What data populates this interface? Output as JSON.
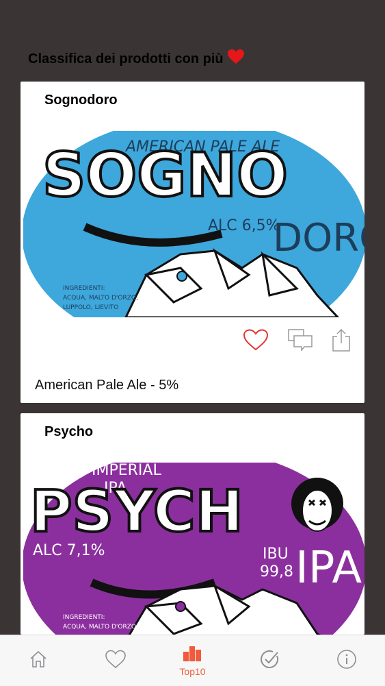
{
  "header": {
    "title": "Classifica dei prodotti con più",
    "heart_icon": "heart-icon"
  },
  "products": [
    {
      "name": "Sognodoro",
      "label": {
        "style": "AMERICAN PALE ALE",
        "word_top": "SOGNO",
        "word_side": "DORO",
        "alc": "ALC 6,5%",
        "ingredients": [
          "INGREDIENTI:",
          "ACQUA, MALTO D'ORZO,",
          "LUPPOLO, LIEVITO"
        ],
        "color": "#3ea7dc"
      },
      "subtitle": "American Pale Ale - 5%"
    },
    {
      "name": "Psycho",
      "label": {
        "style_line1": "IMPERIAL",
        "style_line2": "IPA",
        "word": "PSYCH",
        "alc": "ALC 7,1%",
        "ibu_line1": "IBU",
        "ibu_line2": "99,8",
        "ipa": "IPA",
        "ingredients": [
          "INGREDIENTI:",
          "ACQUA, MALTO D'ORZO,"
        ],
        "color": "#8c2f9e"
      }
    }
  ],
  "actions": {
    "like": "heart-outline-icon",
    "comment": "comments-icon",
    "share": "share-icon"
  },
  "tabbar": {
    "tabs": [
      {
        "icon": "home-icon",
        "label": ""
      },
      {
        "icon": "heart-icon",
        "label": ""
      },
      {
        "icon": "bar-chart-icon",
        "label": "Top10",
        "active": true
      },
      {
        "icon": "check-circle-icon",
        "label": ""
      },
      {
        "icon": "info-icon",
        "label": ""
      }
    ],
    "active_color": "#ef5b3b"
  }
}
